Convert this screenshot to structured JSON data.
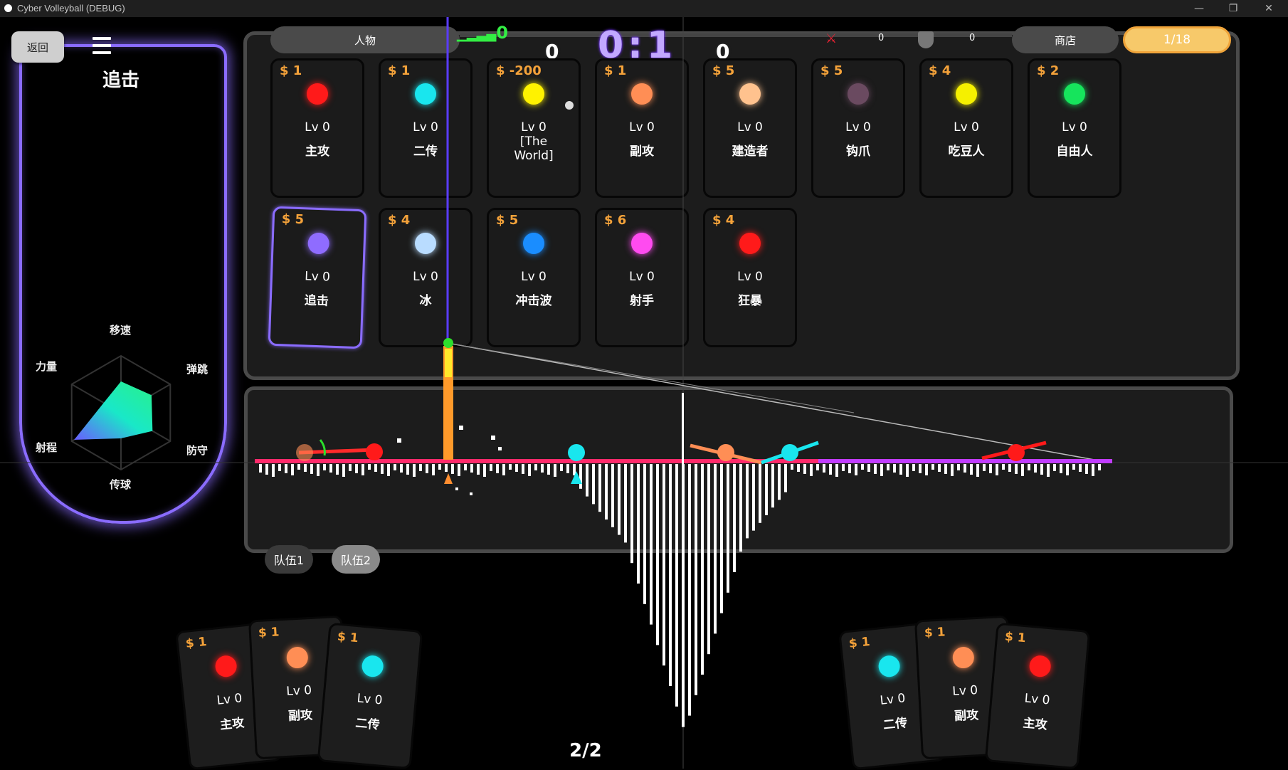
{
  "window": {
    "title": "Cyber Volleyball (DEBUG)",
    "min": "—",
    "restore": "❐",
    "close": "✕"
  },
  "left": {
    "back_label": "返回",
    "character_name": "追击",
    "radar": {
      "labels": [
        "移速",
        "弹跳",
        "防守",
        "传球",
        "射程",
        "力量"
      ],
      "values": [
        0.55,
        0.62,
        0.64,
        0.45,
        0.95,
        0.35
      ]
    }
  },
  "header": {
    "tab_people": "人物",
    "tab_shop": "商店",
    "pager": "1/18",
    "signal": "0",
    "score": "0:1",
    "left_small": "0",
    "right_small": "0",
    "stat1": "0",
    "stat2": "0"
  },
  "shop_cards": [
    {
      "price": "$ 1",
      "lv": "Lv 0",
      "name": "主攻",
      "color": "#ff1a1a"
    },
    {
      "price": "$ 1",
      "lv": "Lv 0",
      "name": "二传",
      "color": "#19e6ee"
    },
    {
      "price": "$ -200",
      "lv": "Lv 0",
      "name": "[The World]",
      "color": "#fff200"
    },
    {
      "price": "$ 1",
      "lv": "Lv 0",
      "name": "副攻",
      "color": "#ff8e55"
    },
    {
      "price": "$ 5",
      "lv": "Lv 0",
      "name": "建造者",
      "color": "#ffc28e"
    },
    {
      "price": "$ 5",
      "lv": "Lv 0",
      "name": "钩爪",
      "color": "#6a4a60"
    },
    {
      "price": "$ 4",
      "lv": "Lv 0",
      "name": "吃豆人",
      "color": "#f5f000"
    },
    {
      "price": "$ 2",
      "lv": "Lv 0",
      "name": "自由人",
      "color": "#16e45c"
    },
    {
      "price": "$ 5",
      "lv": "Lv 0",
      "name": "追击",
      "color": "#8f6cff"
    },
    {
      "price": "$ 4",
      "lv": "Lv 0",
      "name": "冰",
      "color": "#b9dcff"
    },
    {
      "price": "$ 5",
      "lv": "Lv 0",
      "name": "冲击波",
      "color": "#1a8dff"
    },
    {
      "price": "$ 6",
      "lv": "Lv 0",
      "name": "射手",
      "color": "#ff4bf0"
    },
    {
      "price": "$ 4",
      "lv": "Lv 0",
      "name": "狂暴",
      "color": "#ff1a1a"
    }
  ],
  "court": {
    "team1": "队伍1",
    "team2": "队伍2"
  },
  "page_count": "2/2",
  "hand_left": [
    {
      "price": "$ 1",
      "lv": "Lv 0",
      "name": "主攻",
      "color": "#ff1a1a"
    },
    {
      "price": "$ 1",
      "lv": "Lv 0",
      "name": "副攻",
      "color": "#ff8e55"
    },
    {
      "price": "$ 1",
      "lv": "Lv 0",
      "name": "二传",
      "color": "#19e6ee"
    }
  ],
  "hand_right": [
    {
      "price": "$ 1",
      "lv": "Lv 0",
      "name": "二传",
      "color": "#19e6ee"
    },
    {
      "price": "$ 1",
      "lv": "Lv 0",
      "name": "副攻",
      "color": "#ff8e55"
    },
    {
      "price": "$ 1",
      "lv": "Lv 0",
      "name": "主攻",
      "color": "#ff1a1a"
    }
  ]
}
